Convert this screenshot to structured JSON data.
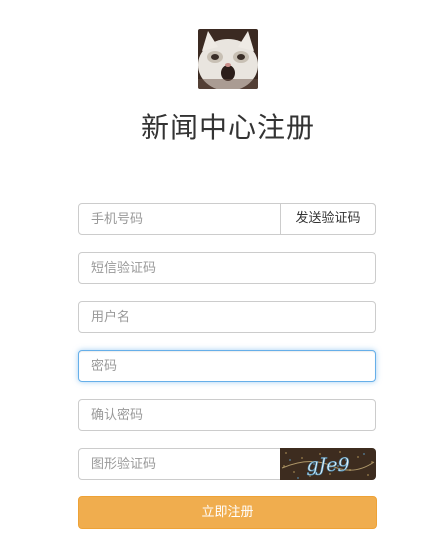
{
  "header": {
    "title": "新闻中心注册"
  },
  "form": {
    "phone": {
      "placeholder": "手机号码",
      "value": ""
    },
    "send_code_label": "发送验证码",
    "sms_code": {
      "placeholder": "短信验证码",
      "value": ""
    },
    "username": {
      "placeholder": "用户名",
      "value": ""
    },
    "password": {
      "placeholder": "密码",
      "value": ""
    },
    "confirm_password": {
      "placeholder": "确认密码",
      "value": ""
    },
    "image_code": {
      "placeholder": "图形验证码",
      "value": ""
    },
    "captcha_text": "gJe9",
    "submit_label": "立即注册"
  },
  "colors": {
    "submit": "#f0ad4e",
    "focus_border": "#66afe9",
    "input_border": "#cccccc"
  }
}
